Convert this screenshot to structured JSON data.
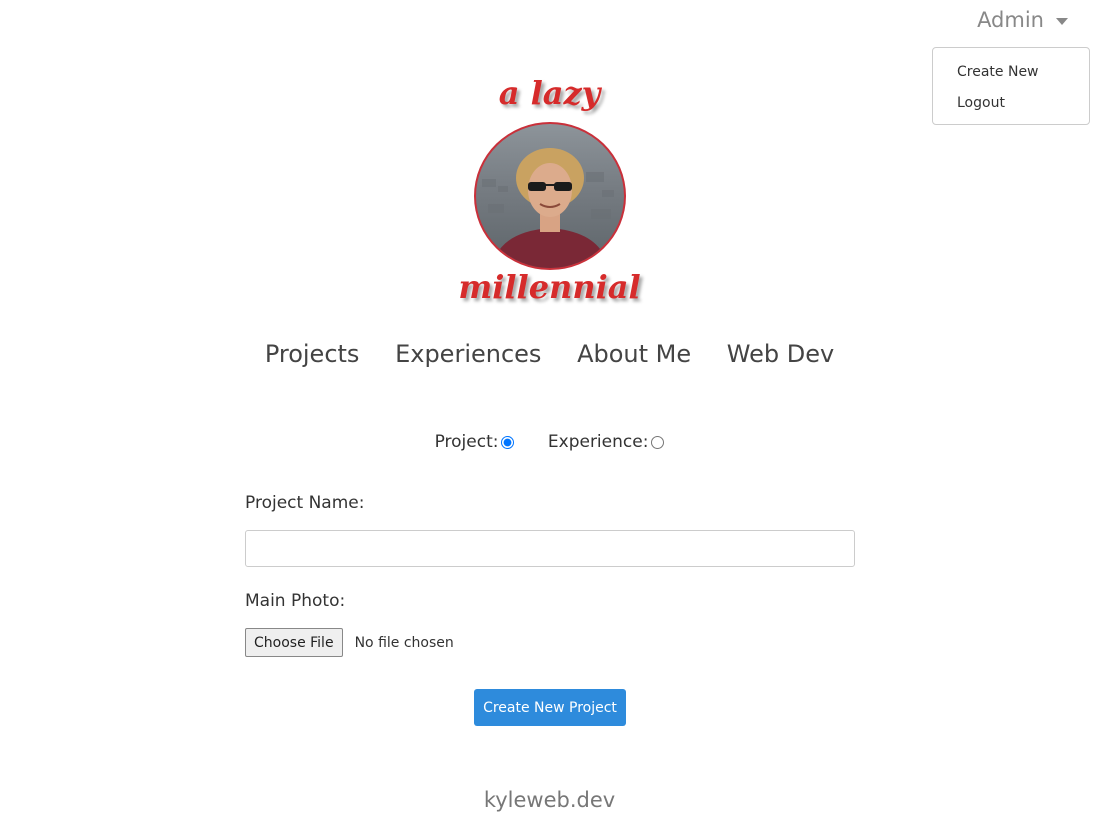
{
  "header": {
    "admin_label": "Admin",
    "dropdown": [
      {
        "label": "Create New"
      },
      {
        "label": "Logout"
      }
    ]
  },
  "logo": {
    "top": "a lazy",
    "bottom": "millennial"
  },
  "nav": [
    {
      "label": "Projects"
    },
    {
      "label": "Experiences"
    },
    {
      "label": "About Me"
    },
    {
      "label": "Web Dev"
    }
  ],
  "form": {
    "type_options": [
      {
        "label": "Project:",
        "checked": true
      },
      {
        "label": "Experience:",
        "checked": false
      }
    ],
    "name_label": "Project Name:",
    "name_value": "",
    "photo_label": "Main Photo:",
    "file_button": "Choose File",
    "file_status": "No file chosen",
    "submit_label": "Create New Project"
  },
  "footer": {
    "text": "kyleweb.dev"
  },
  "colors": {
    "accent": "#2e8bdc",
    "logo_red": "#d62b2b"
  }
}
